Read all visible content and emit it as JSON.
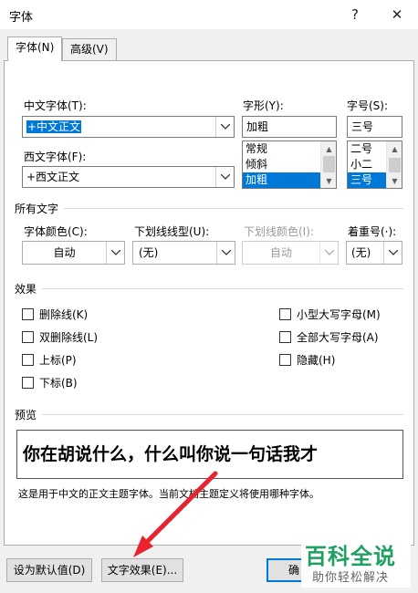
{
  "dialog": {
    "title": "字体",
    "help": "?",
    "close": "✕"
  },
  "tabs": [
    {
      "label": "字体(N)"
    },
    {
      "label": "高级(V)"
    }
  ],
  "font": {
    "cn_label": "中文字体(T):",
    "cn_value": "+中文正文",
    "west_label": "西文字体(F):",
    "west_value": "+西文正文",
    "style_label": "字形(Y):",
    "style_value": "加粗",
    "style_options": [
      "常规",
      "倾斜",
      "加粗"
    ],
    "style_selected": "加粗",
    "size_label": "字号(S):",
    "size_value": "三号",
    "size_options": [
      "二号",
      "小二",
      "三号"
    ],
    "size_selected": "三号"
  },
  "all_text": {
    "section": "所有文字",
    "color_label": "字体颜色(C):",
    "color_value": "自动",
    "underline_label": "下划线线型(U):",
    "underline_value": "(无)",
    "underline_color_label": "下划线颜色(I):",
    "underline_color_value": "自动",
    "emphasis_label": "着重号(·):",
    "emphasis_value": "(无)"
  },
  "effects": {
    "section": "效果",
    "left": [
      "删除线(K)",
      "双删除线(L)",
      "上标(P)",
      "下标(B)"
    ],
    "right": [
      "小型大写字母(M)",
      "全部大写字母(A)",
      "隐藏(H)"
    ]
  },
  "preview": {
    "section": "预览",
    "text": "你在胡说什么，什么叫你说一句话我才",
    "note": "这是用于中文的正文主题字体。当前文档主题定义将使用哪种字体。"
  },
  "buttons": {
    "default": "设为默认值(D)",
    "text_effects": "文字效果(E)...",
    "ok": "确"
  },
  "watermark": {
    "title": "百科全说",
    "sub": "助你轻松解决"
  },
  "colors": {
    "accent": "#0078d7",
    "arrow": "#e8232c",
    "watermark": "#20a060"
  }
}
